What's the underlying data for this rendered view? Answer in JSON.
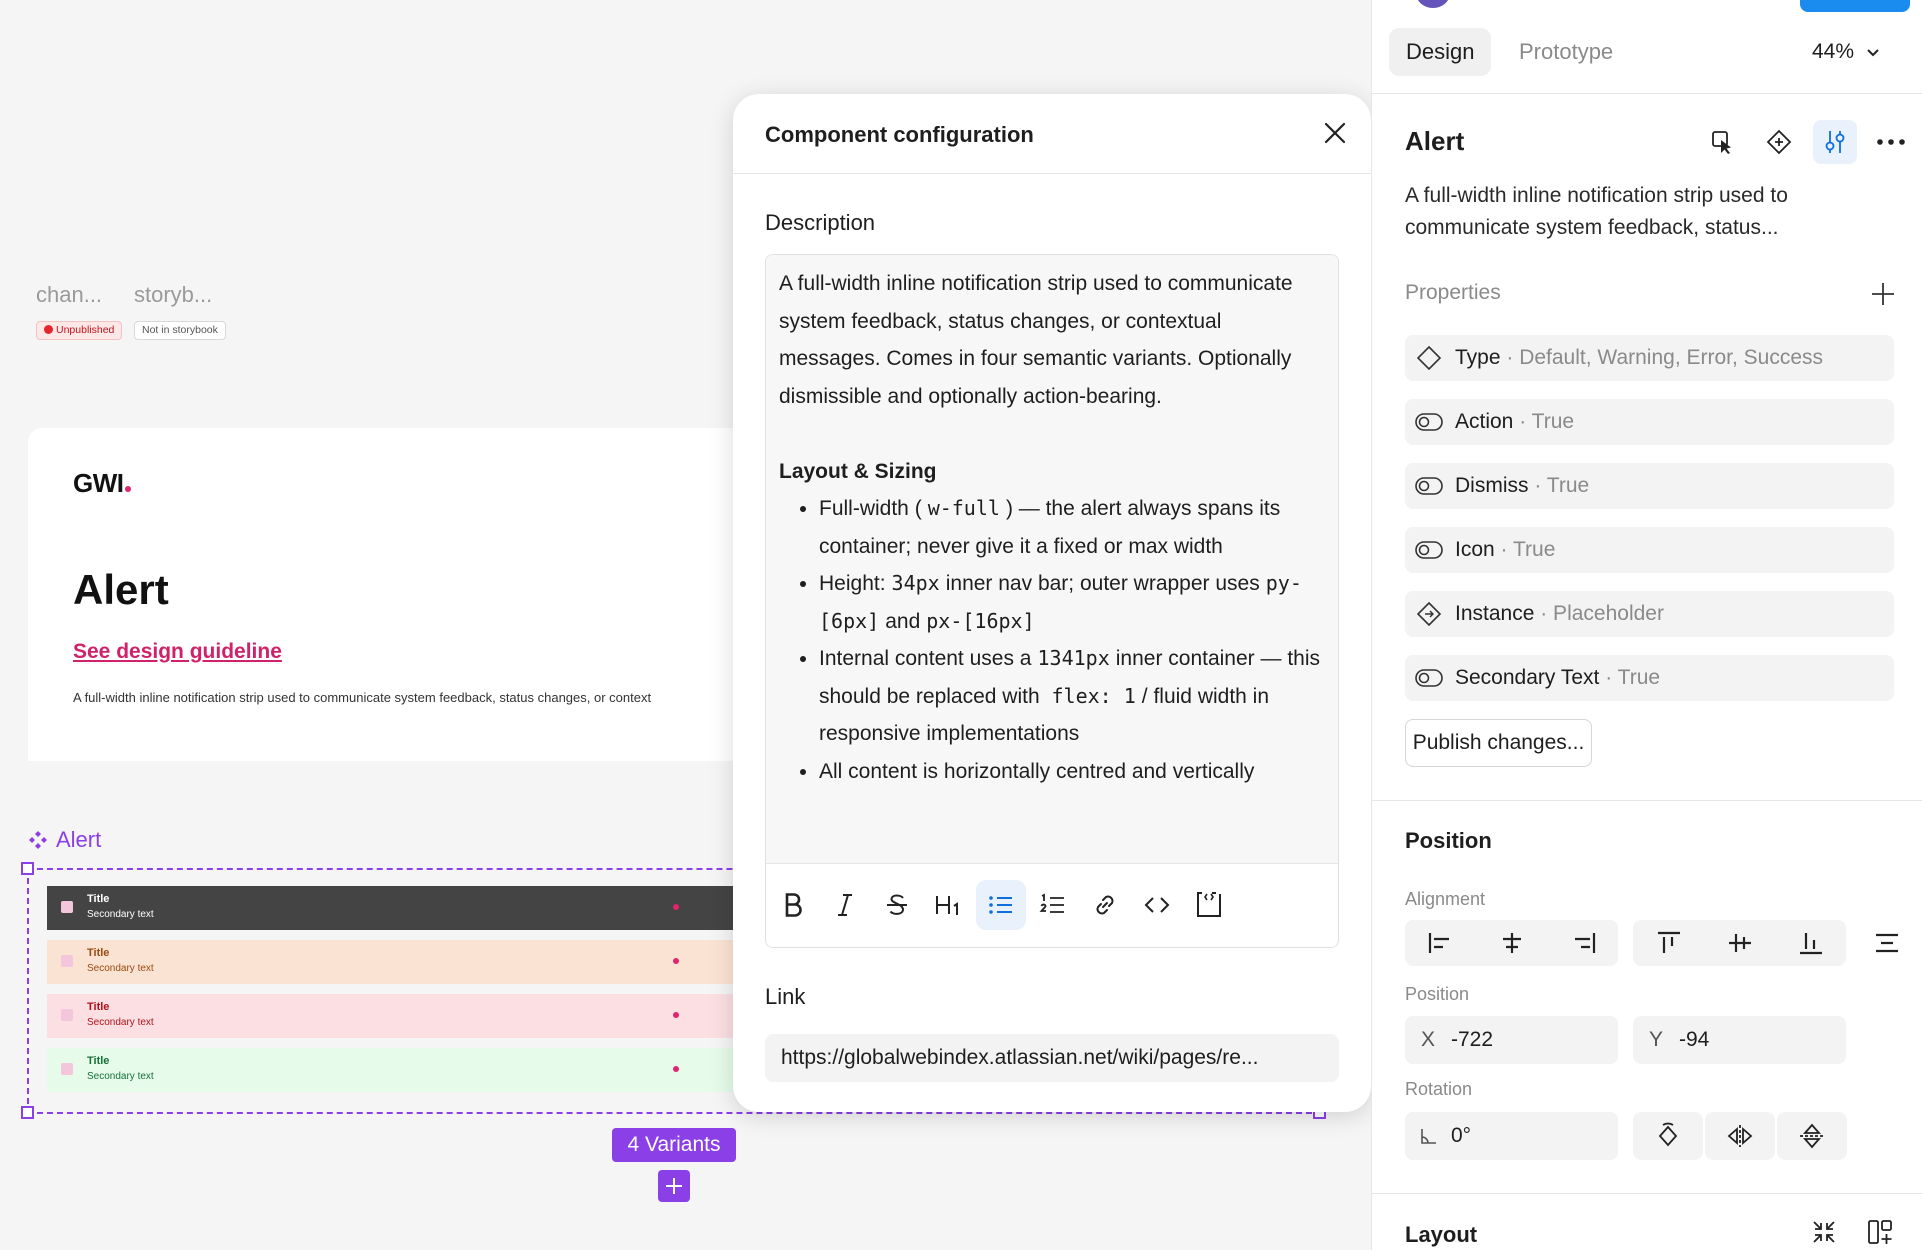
{
  "canvas": {
    "pill_labels": [
      "chan...",
      "storyb..."
    ],
    "badges": [
      "Unpublished",
      "Not in storybook"
    ],
    "doc_card": {
      "logo": "GWI",
      "title": "Alert",
      "link": "See design guideline",
      "description": "A full-width inline notification strip used to communicate system feedback, status changes, or context"
    },
    "component_label": "Alert",
    "variants": [
      {
        "title": "Title",
        "secondary": "Secondary text",
        "bg": "#444444",
        "text": "#ffffff",
        "square": "#f3c6dc",
        "dot": "#e0246f"
      },
      {
        "title": "Title",
        "secondary": "Secondary text",
        "bg": "#fbe3d3",
        "text": "#9a4a12",
        "square": "#f3c6dc",
        "dot": "#e0246f"
      },
      {
        "title": "Title",
        "secondary": "Secondary text",
        "bg": "#fbdfe2",
        "text": "#b3121b",
        "square": "#f3c6dc",
        "dot": "#e0246f"
      },
      {
        "title": "Title",
        "secondary": "Secondary text",
        "bg": "#e6fbea",
        "text": "#17703a",
        "square": "#f3c6dc",
        "dot": "#e0246f"
      }
    ],
    "variants_badge": "4 Variants"
  },
  "modal": {
    "title": "Component configuration",
    "description_label": "Description",
    "paragraph": "A full-width inline notification strip used to communicate system feedback, status changes, or contextual messages. Comes in four semantic variants. Optionally dismissible and optionally action-bearing.",
    "heading": "Layout & Sizing",
    "bullets": {
      "b1_pre": "Full-width (",
      "b1_code": "w-full",
      "b1_post": ") — the alert always spans its container; never give it a fixed or max width",
      "b2_pre": "Height:",
      "b2_code1": "34px",
      "b2_mid": "inner nav bar; outer wrapper uses",
      "b2_code2": "py-[6px]",
      "b2_and": "and",
      "b2_code3": "px-[16px]",
      "b3_pre": "Internal content uses a",
      "b3_code1": "1341px",
      "b3_mid": "inner container — this should be replaced with",
      "b3_code2": "flex: 1",
      "b3_post": "/ fluid width in responsive implementations",
      "b4": "All content is horizontally centred and vertically"
    },
    "toolbar_icons": [
      "bold-icon",
      "italic-icon",
      "strikethrough-icon",
      "heading-icon",
      "bullet-list-icon",
      "numbered-list-icon",
      "link-icon",
      "code-icon",
      "code-block-icon"
    ],
    "link_label": "Link",
    "link_value": "https://globalwebindex.atlassian.net/wiki/pages/re..."
  },
  "panel": {
    "tabs": [
      "Design",
      "Prototype"
    ],
    "zoom": "44%",
    "component_name": "Alert",
    "component_desc": "A full-width inline notification strip used to communicate system feedback, status...",
    "properties_label": "Properties",
    "properties": [
      {
        "name": "Type",
        "value": "· Default, Warning, Error, Success",
        "icon": "variant-icon"
      },
      {
        "name": "Action",
        "value": "· True",
        "icon": "boolean-icon"
      },
      {
        "name": "Dismiss",
        "value": "· True",
        "icon": "boolean-icon"
      },
      {
        "name": "Icon",
        "value": "· True",
        "icon": "boolean-icon"
      },
      {
        "name": "Instance",
        "value": "· Placeholder",
        "icon": "instance-swap-icon"
      },
      {
        "name": "Secondary Text",
        "value": "· True",
        "icon": "boolean-icon"
      }
    ],
    "publish_button": "Publish changes...",
    "position_title": "Position",
    "alignment_label": "Alignment",
    "position_label": "Position",
    "x_label": "X",
    "x_value": "-722",
    "y_label": "Y",
    "y_value": "-94",
    "rotation_label": "Rotation",
    "rotation_value": "0°",
    "layout_title": "Layout"
  },
  "colors": {
    "accent_purple": "#8b3fe6",
    "accent_blue": "#0d6fe0",
    "brand_pink": "#d0226a"
  }
}
